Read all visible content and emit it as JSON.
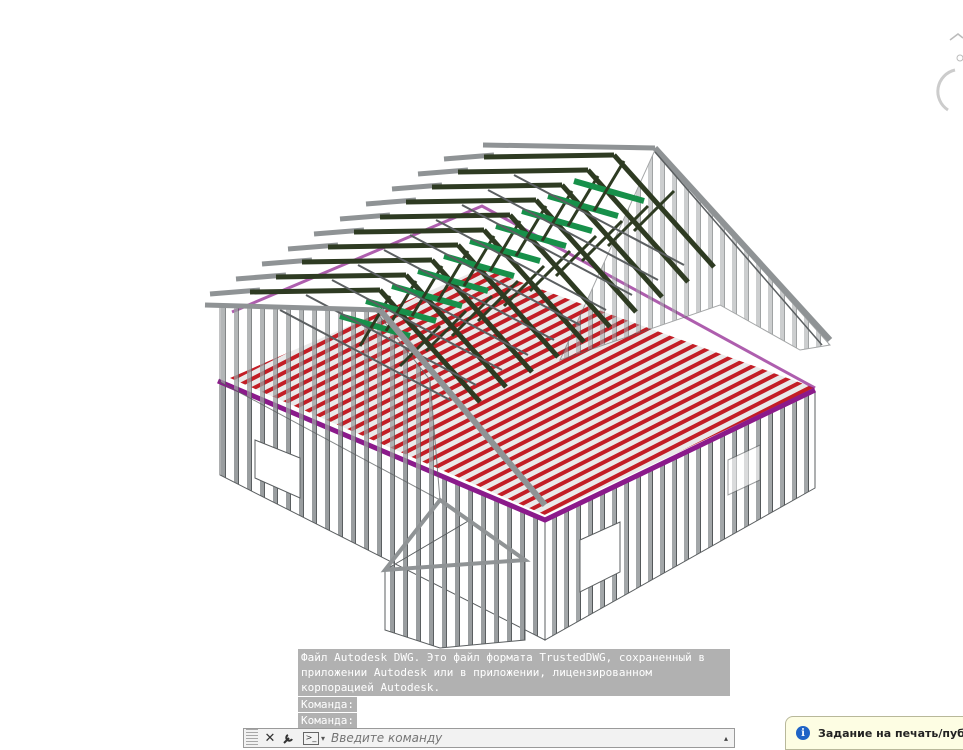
{
  "command_history": {
    "message": "Файл Autodesk DWG. Это файл формата TrustedDWG, сохраненный в приложении Autodesk или в приложении, лицензированном корпорацией Autodesk.",
    "lines": [
      "Команда:",
      "Команда:"
    ]
  },
  "command_line": {
    "placeholder": "Введите команду",
    "close_icon": "close-icon",
    "settings_icon": "wrench-icon",
    "prompt_icon": "command-prompt-icon"
  },
  "notification": {
    "text": "Задание на печать/публи",
    "icon": "info-icon"
  },
  "colors": {
    "steel": "#8f9395",
    "steel_dark": "#5b5f61",
    "floor_joist": "#c0121b",
    "band": "#8b1a8b",
    "truss_dark": "#2e3b22",
    "truss_green": "#17904a"
  }
}
